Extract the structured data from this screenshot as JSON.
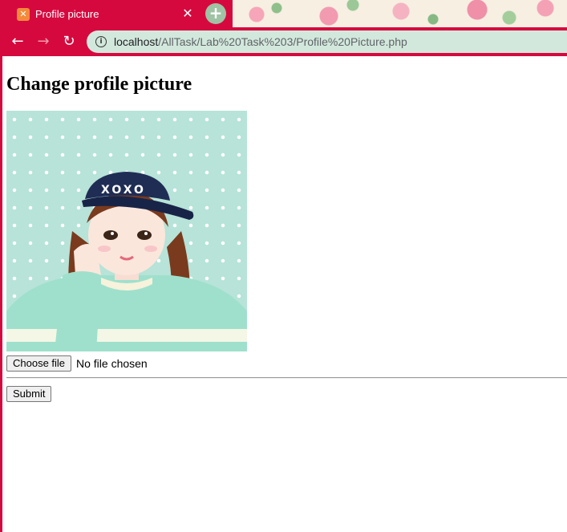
{
  "browser": {
    "tab": {
      "title": "Profile picture",
      "favicon_icon": "xampp-icon"
    },
    "close_icon": "close-icon",
    "new_tab_icon": "plus-icon",
    "back_icon": "arrow-left-icon",
    "forward_icon": "arrow-right-icon",
    "reload_icon": "reload-icon",
    "address": {
      "info_icon": "info-icon",
      "host": "localhost",
      "path": "/AllTask/Lab%20Task%203/Profile%20Picture.php"
    },
    "theme_color": "#d6093f"
  },
  "page": {
    "heading": "Change profile picture",
    "profile_image": "cartoon girl with navy XOXO cap and mint sweater",
    "file_input": {
      "button_label": "Choose file",
      "status": "No file chosen"
    },
    "submit_label": "Submit"
  },
  "image_text": {
    "cap_text": "XOXO"
  }
}
